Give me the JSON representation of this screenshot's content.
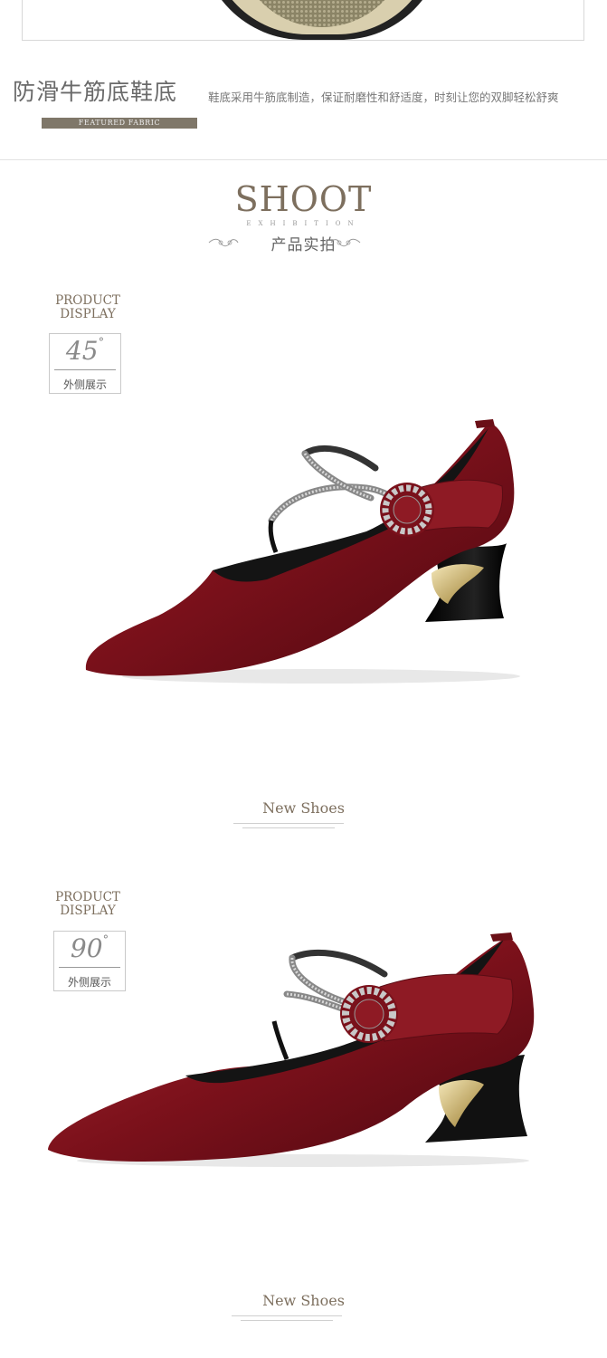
{
  "fabric": {
    "title": "防滑牛筋底鞋底",
    "description": "鞋底采用牛筋底制造，保证耐磨性和舒适度，时刻让您的双脚轻松舒爽",
    "tag": "FEATURED FABRIC"
  },
  "shoot": {
    "title": "SHOOT",
    "subtitle": "EXHIBITION",
    "title_cn": "产品实拍"
  },
  "displays": [
    {
      "label_line1": "PRODUCT",
      "label_line2": "DISPLAY",
      "angle": "45",
      "degree_symbol": "°",
      "angle_cn": "外侧展示",
      "caption": "New Shoes"
    },
    {
      "label_line1": "PRODUCT",
      "label_line2": "DISPLAY",
      "angle": "90",
      "degree_symbol": "°",
      "angle_cn": "外侧展示",
      "caption": "New Shoes"
    }
  ],
  "colors": {
    "shoe_main": "#8a1722",
    "shoe_dark": "#5a0c14",
    "shoe_highlight": "#c2474e",
    "accent_text": "#7d6f5e",
    "fabric_bar": "#7f7769"
  },
  "icons": {
    "ornament_left": "scroll-ornament-icon",
    "ornament_right": "scroll-ornament-icon",
    "buckle": "rhinestone-flower-buckle-icon"
  }
}
